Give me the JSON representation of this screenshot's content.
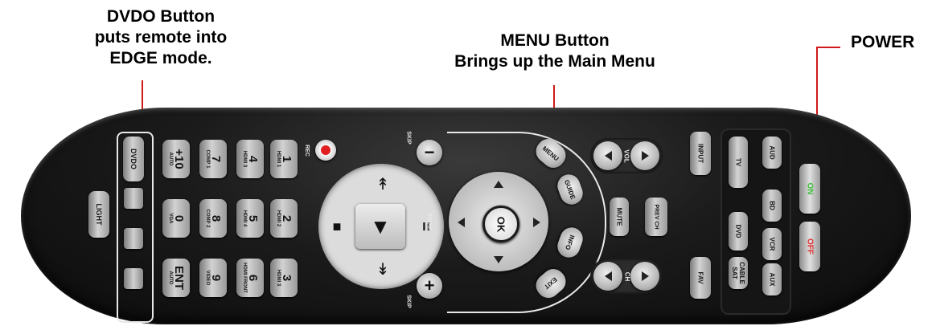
{
  "callouts": {
    "dvdo": "DVDO Button\nputs remote into\nEDGE mode.",
    "menu": "MENU Button\nBrings up the Main Menu",
    "power": "POWER"
  },
  "colors": {
    "leader": "#d01a1a",
    "rec_dot": "#e02020",
    "on_text": "#3dbf3d",
    "off_text": "#e03030"
  },
  "remote": {
    "left_column": {
      "light": "LIGHT",
      "dvdo": "DVDO"
    },
    "number_pad": [
      {
        "num": "+10",
        "sub": "AUTO"
      },
      {
        "num": "7",
        "sub": "COMP 1"
      },
      {
        "num": "4",
        "sub": "HDMI 3"
      },
      {
        "num": "1",
        "sub": "HDMI 1"
      },
      {
        "num": "0",
        "sub": "VGA"
      },
      {
        "num": "8",
        "sub": "COMP 2"
      },
      {
        "num": "5",
        "sub": "HDMI 4"
      },
      {
        "num": "2",
        "sub": "HDMI 2"
      },
      {
        "num": "ENT",
        "sub": "AUTO"
      },
      {
        "num": "9",
        "sub": "VIDEO"
      },
      {
        "num": "6",
        "sub": "HDMI FRONT"
      },
      {
        "num": "3",
        "sub": "HDMI 3"
      }
    ],
    "rec": "REC",
    "skip_top": "SKIP",
    "skip_bottom": "SKIP",
    "zoom": "ZOOM",
    "transport_glyphs": {
      "up": "↟",
      "down": "↡",
      "stop": "■",
      "play": "▼",
      "pause": "="
    },
    "nav": {
      "menu": "MENU",
      "guide": "GUIDE",
      "info": "INFO",
      "exit": "EXIT",
      "ok": "OK"
    },
    "vol": "VOL",
    "ch": "CH",
    "mute": "MUTE",
    "prev_ch": "PREV CH",
    "input": "INPUT",
    "fav": "FAV",
    "sources": [
      "TV",
      "AUD",
      "BD",
      "DVD",
      "VCR",
      "CABLE SAT",
      "AUX"
    ],
    "power_on": "ON",
    "power_off": "OFF"
  }
}
